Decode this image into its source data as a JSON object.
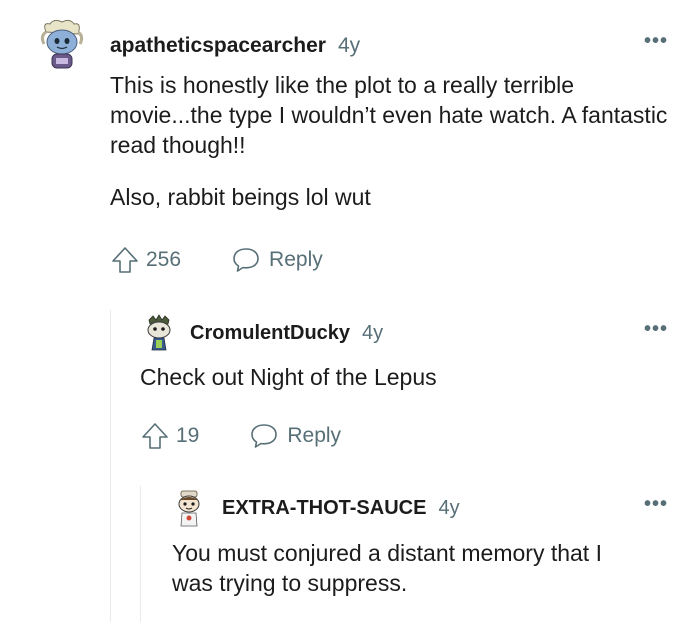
{
  "comments": [
    {
      "username": "apatheticspacearcher",
      "time": "4y",
      "more": "•••",
      "paragraphs": [
        "This is honestly like the plot to a really terrible movie...the type I wouldn’t even hate watch. A fantastic read though!!",
        "Also, rabbit beings lol wut"
      ],
      "votes": "256",
      "reply_label": "Reply",
      "avatar_icon": "snoo-avatar-icon"
    },
    {
      "username": "CromulentDucky",
      "time": "4y",
      "more": "•••",
      "paragraphs": [
        "Check out Night of the Lepus"
      ],
      "votes": "19",
      "reply_label": "Reply",
      "avatar_icon": "snoo-avatar-icon"
    },
    {
      "username": "EXTRA-THOT-SAUCE",
      "time": "4y",
      "more": "•••",
      "paragraphs": [
        "You must conjured a distant memory that I was trying to suppress."
      ],
      "avatar_icon": "snoo-avatar-icon"
    }
  ],
  "colors": {
    "text": "#1c1c1c",
    "meta": "#576f76",
    "thread_line": "#e5ebee"
  }
}
